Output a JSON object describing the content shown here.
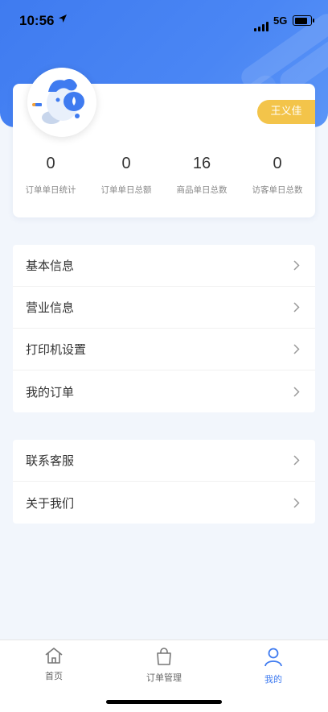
{
  "status_bar": {
    "time": "10:56",
    "network": "5G"
  },
  "profile": {
    "name": "王义佳",
    "stats": [
      {
        "value": "0",
        "label": "订单单日统计"
      },
      {
        "value": "0",
        "label": "订单单日总额"
      },
      {
        "value": "16",
        "label": "商品单日总数"
      },
      {
        "value": "0",
        "label": "访客单日总数"
      }
    ]
  },
  "menu_primary": [
    {
      "label": "基本信息"
    },
    {
      "label": "营业信息"
    },
    {
      "label": "打印机设置"
    },
    {
      "label": "我的订单"
    }
  ],
  "menu_secondary": [
    {
      "label": "联系客服"
    },
    {
      "label": "关于我们"
    }
  ],
  "tabbar": [
    {
      "label": "首页",
      "icon": "home-icon",
      "active": false
    },
    {
      "label": "订单管理",
      "icon": "shopping-bag-icon",
      "active": false
    },
    {
      "label": "我的",
      "icon": "person-icon",
      "active": true
    }
  ],
  "colors": {
    "primary": "#3f7bf0",
    "badge": "#f3c44a",
    "background": "#f2f6fc"
  }
}
